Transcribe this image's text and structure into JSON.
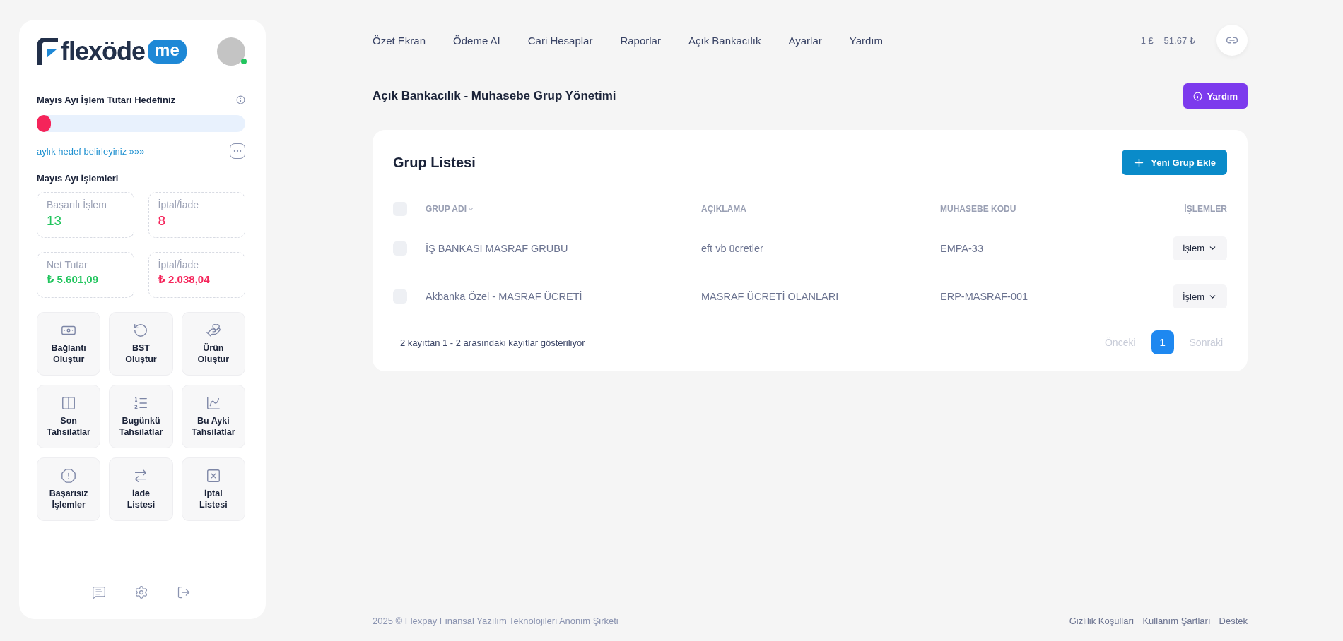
{
  "sidebar": {
    "logo": {
      "word": "flexöde",
      "badge": "me"
    },
    "avatar": {
      "online": true
    },
    "goal": {
      "title": "Mayıs Ayı İşlem Tutarı Hedefiniz",
      "level": 0.03,
      "link": "aylık hedef belirleyiniz »»»"
    },
    "stats_title": "Mayıs Ayı İşlemleri",
    "stats": [
      {
        "label": "Başarılı İşlem",
        "value": "13",
        "color": "#22c55e"
      },
      {
        "label": "İptal/İade",
        "value": "8",
        "color": "#f5245a"
      },
      {
        "label": "Net Tutar",
        "value": "₺ 5.601,09",
        "color": "#22c55e"
      },
      {
        "label": "İptal/İade",
        "value": "₺ 2.038,04",
        "color": "#f5245a"
      }
    ],
    "tiles": [
      {
        "label": "Bağlantı Oluştur"
      },
      {
        "label": "BST Oluştur"
      },
      {
        "label": "Ürün Oluştur"
      },
      {
        "label": "Son Tahsilatlar"
      },
      {
        "label": "Bugünkü Tahsilatlar"
      },
      {
        "label": "Bu Ayki Tahsilatlar"
      },
      {
        "label": "Başarısız İşlemler"
      },
      {
        "label": "İade Listesi"
      },
      {
        "label": "İptal Listesi"
      }
    ]
  },
  "nav": {
    "items": [
      {
        "label": "Özet Ekran"
      },
      {
        "label": "Ödeme AI"
      },
      {
        "label": "Cari Hesaplar"
      },
      {
        "label": "Raporlar"
      },
      {
        "label": "Açık Bankacılık"
      },
      {
        "label": "Ayarlar"
      },
      {
        "label": "Yardım"
      }
    ],
    "rate": "1 £ = 51.67 ₺"
  },
  "page_title": "Açık Bankacılık - Muhasebe Grup Yönetimi",
  "help_button": "Yardım",
  "card": {
    "title": "Grup Listesi",
    "add_button": "Yeni Grup Ekle",
    "columns": [
      "GRUP ADI",
      "AÇIKLAMA",
      "MUHASEBE KODU",
      "İŞLEMLER"
    ],
    "header_checked": false,
    "rows": [
      {
        "checked": false,
        "name": "İŞ BANKASI MASRAF GRUBU",
        "description": "eft vb ücretler",
        "code": "EMPA-33",
        "action": "İşlem"
      },
      {
        "checked": false,
        "name": "Akbanka Özel - MASRAF ÜCRETİ",
        "description": "MASRAF ÜCRETİ OLANLARI",
        "code": "ERP-MASRAF-001",
        "action": "İşlem"
      }
    ],
    "summary": "2 kayıttan 1 - 2 arasındaki kayıtlar gösteriliyor",
    "prev": {
      "label": "Önceki",
      "disabled": true
    },
    "pages": [
      {
        "label": "1",
        "selected": true
      }
    ],
    "next": {
      "label": "Sonraki",
      "disabled": true
    }
  },
  "footer": {
    "copyright": "2025 © Flexpay Finansal Yazılım Teknolojileri Anonim Şirketi",
    "links": [
      "Gizlilik Koşulları",
      "Kullanım Şartları",
      "Destek"
    ]
  }
}
